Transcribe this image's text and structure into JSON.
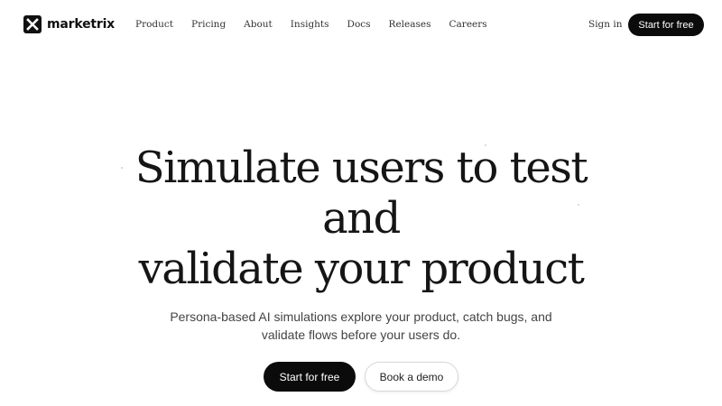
{
  "brand": {
    "name": "marketrix",
    "logo_icon": "x-logo-icon"
  },
  "nav": {
    "links": [
      "Product",
      "Pricing",
      "About",
      "Insights",
      "Docs",
      "Releases",
      "Careers"
    ],
    "sign_in": "Sign in",
    "cta": "Start for free"
  },
  "hero": {
    "title_lines": [
      "Simulate users to test",
      "and",
      "validate your product"
    ],
    "subtitle_lines": [
      "Persona-based AI simulations explore your product, catch bugs, and",
      "validate flows before your users do."
    ],
    "primary_button": "Start for free",
    "secondary_button": "Book a demo"
  },
  "colors": {
    "primary": "#0b0b0b",
    "text": "#151515",
    "muted": "#444444",
    "background": "#ffffff"
  }
}
